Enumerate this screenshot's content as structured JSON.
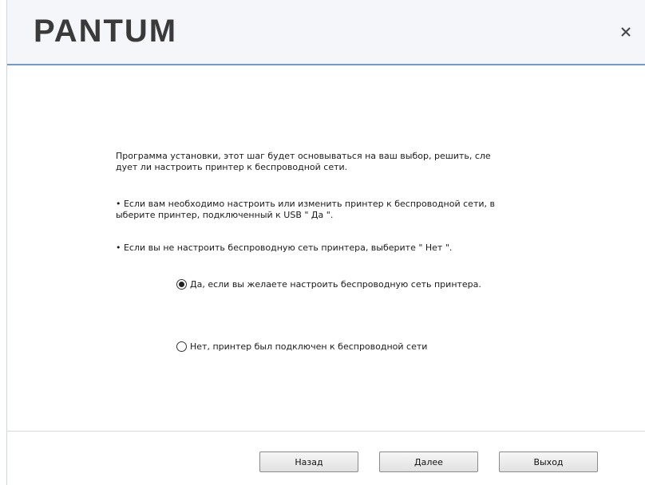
{
  "header": {
    "logo_text": "PANTUM",
    "close_icon": "close-icon"
  },
  "content": {
    "intro": "Программа установки, этот шаг будет основываться на ваш выбор, решить, сле дует ли настроить принтер к беспроводной сети.",
    "bullet1": "• Если вам необходимо настроить или изменить принтер к беспроводной сети, в ыберите принтер, подключенный к USB \" Да \".",
    "bullet2": "• Если вы не настроить беспроводную сеть принтера, выберите \" Нет \".",
    "options": [
      {
        "label": "Да, если вы желаете настроить беспроводную сеть принтера.",
        "selected": true
      },
      {
        "label": "Нет, принтер был подключен к беспроводной сети",
        "selected": false
      }
    ]
  },
  "footer": {
    "back_label": "Назад",
    "next_label": "Далее",
    "exit_label": "Выход"
  },
  "colors": {
    "header_bg": "#f4f6f9",
    "header_line": "#6f9bd4",
    "logo": "#3a3a3a"
  }
}
